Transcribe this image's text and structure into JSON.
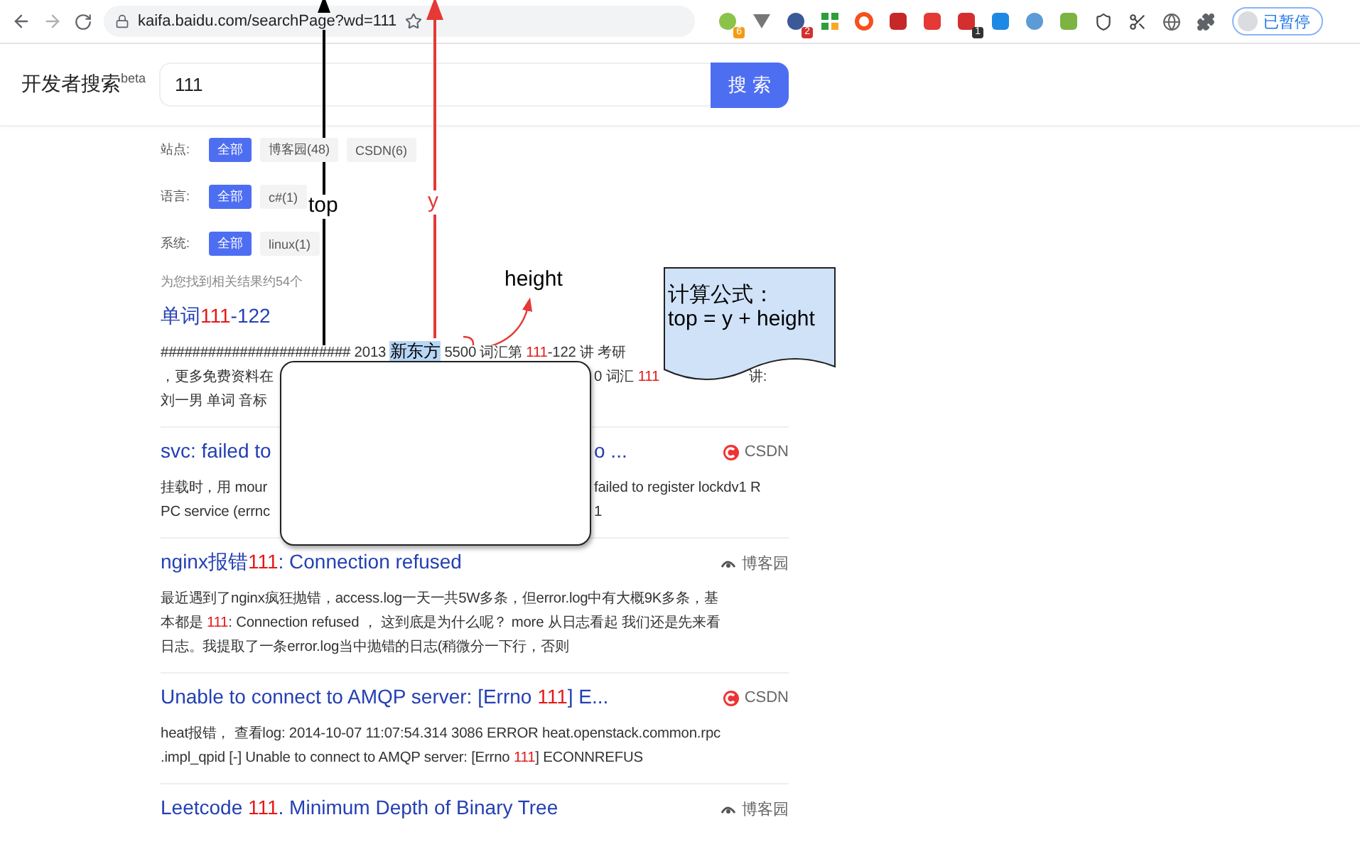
{
  "browser": {
    "url": "kaifa.baidu.com/searchPage?wd=111",
    "extensions": [
      {
        "kind": "orb",
        "badge": "6"
      },
      {
        "kind": "vee"
      },
      {
        "kind": "target",
        "badge": "2"
      },
      {
        "kind": "grid"
      },
      {
        "kind": "ring"
      },
      {
        "kind": "square"
      },
      {
        "kind": "person"
      },
      {
        "kind": "calendar",
        "badge": "1"
      },
      {
        "kind": "bluesquare"
      },
      {
        "kind": "orb2"
      },
      {
        "kind": "leaf"
      },
      {
        "kind": "shield"
      },
      {
        "kind": "scissors"
      },
      {
        "kind": "globe"
      },
      {
        "kind": "puzzle"
      }
    ],
    "profile": "已暂停"
  },
  "header": {
    "logo": "开发者搜索",
    "logo_sup": "beta",
    "query": "111",
    "search_button": "搜 索"
  },
  "filters": [
    {
      "label": "站点:",
      "chips": [
        {
          "text": "全部",
          "selected": true
        },
        {
          "text": "博客园(48)",
          "selected": false
        },
        {
          "text": "CSDN(6)",
          "selected": false
        }
      ]
    },
    {
      "label": "语言:",
      "chips": [
        {
          "text": "全部",
          "selected": true
        },
        {
          "text": "c#(1)",
          "selected": false
        }
      ]
    },
    {
      "label": "系统:",
      "chips": [
        {
          "text": "全部",
          "selected": true
        },
        {
          "text": "linux(1)",
          "selected": false
        }
      ]
    }
  ],
  "result_count": "为您找到相关结果约54个",
  "results": [
    {
      "title": [
        [
          {
            "kind": "plain",
            "text": "单词"
          },
          {
            "kind": "match",
            "text": "111"
          },
          {
            "kind": "plain",
            "text": "-122"
          }
        ]
      ],
      "lines": [
        [
          [
            {
              "kind": "plain",
              "text": "######################## 2013 "
            },
            {
              "kind": "selection",
              "text": "新东方"
            },
            {
              "kind": "plain",
              "text": " 5500 词汇第 "
            },
            {
              "kind": "match",
              "text": "111"
            },
            {
              "kind": "plain",
              "text": "-122 讲 考研"
            }
          ]
        ],
        [
          [
            {
              "kind": "plain",
              "text": "，更多免费资料在"
            }
          ],
          [
            {
              "kind": "plain",
              "text": "0 词汇 "
            },
            {
              "kind": "match",
              "text": "111"
            }
          ],
          [
            {
              "kind": "plain",
              "text": "讲:"
            }
          ]
        ],
        [
          [
            {
              "kind": "plain",
              "text": "刘一男 单词 音标"
            }
          ]
        ]
      ]
    },
    {
      "title": [
        [
          {
            "kind": "plain",
            "text": "svc: failed to"
          }
        ],
        [
          {
            "kind": "plain",
            "text": "o ..."
          }
        ]
      ],
      "source": {
        "kind": "csdn",
        "name": "CSDN"
      },
      "lines": [
        [
          [
            {
              "kind": "plain",
              "text": "挂载时，用 mour"
            }
          ],
          [
            {
              "kind": "plain",
              "text": "failed to register lockdv1 R"
            }
          ]
        ],
        [
          [
            {
              "kind": "plain",
              "text": "PC service (errnc"
            }
          ],
          [
            {
              "kind": "plain",
              "text": "1"
            }
          ]
        ]
      ]
    },
    {
      "title": [
        [
          {
            "kind": "plain",
            "text": "nginx报错"
          },
          {
            "kind": "match",
            "text": "111"
          },
          {
            "kind": "plain",
            "text": ": Connection refused"
          }
        ]
      ],
      "source": {
        "kind": "cnblogs",
        "name": "博客园"
      },
      "lines": [
        [
          [
            {
              "kind": "plain",
              "text": "最近遇到了nginx疯狂抛错，access.log一天一共5W多条，但error.log中有大概9K多条，基"
            }
          ]
        ],
        [
          [
            {
              "kind": "plain",
              "text": "本都是 "
            },
            {
              "kind": "match",
              "text": "111"
            },
            {
              "kind": "plain",
              "text": ": Connection refused ， 这到底是为什么呢？ more 从日志看起 我们还是先来看"
            }
          ]
        ],
        [
          [
            {
              "kind": "plain",
              "text": "日志。我提取了一条error.log当中抛错的日志(稍微分一下行，否则"
            }
          ]
        ]
      ]
    },
    {
      "title": [
        [
          {
            "kind": "plain",
            "text": "Unable to connect to AMQP server: [Errno "
          },
          {
            "kind": "match",
            "text": "111"
          },
          {
            "kind": "plain",
            "text": "] E..."
          }
        ]
      ],
      "source": {
        "kind": "csdn",
        "name": "CSDN"
      },
      "lines": [
        [
          [
            {
              "kind": "plain",
              "text": "heat报错， 查看log: 2014-10-07 11:07:54.314 3086 ERROR heat.openstack.common.rpc"
            }
          ]
        ],
        [
          [
            {
              "kind": "plain",
              "text": ".impl_qpid [-] Unable to connect to AMQP server: [Errno "
            },
            {
              "kind": "match",
              "text": "111"
            },
            {
              "kind": "plain",
              "text": "] ECONNREFUS"
            }
          ]
        ]
      ]
    },
    {
      "title": [
        [
          {
            "kind": "plain",
            "text": "Leetcode "
          },
          {
            "kind": "match",
            "text": "111"
          },
          {
            "kind": "plain",
            "text": ". Minimum Depth of Binary Tree"
          }
        ]
      ],
      "source": {
        "kind": "cnblogs",
        "name": "博客园"
      }
    }
  ],
  "annotations": {
    "top_label": "top",
    "y_label": "y",
    "height_label": "height",
    "note_lines": [
      "计算公式：",
      "top = y + height"
    ]
  }
}
